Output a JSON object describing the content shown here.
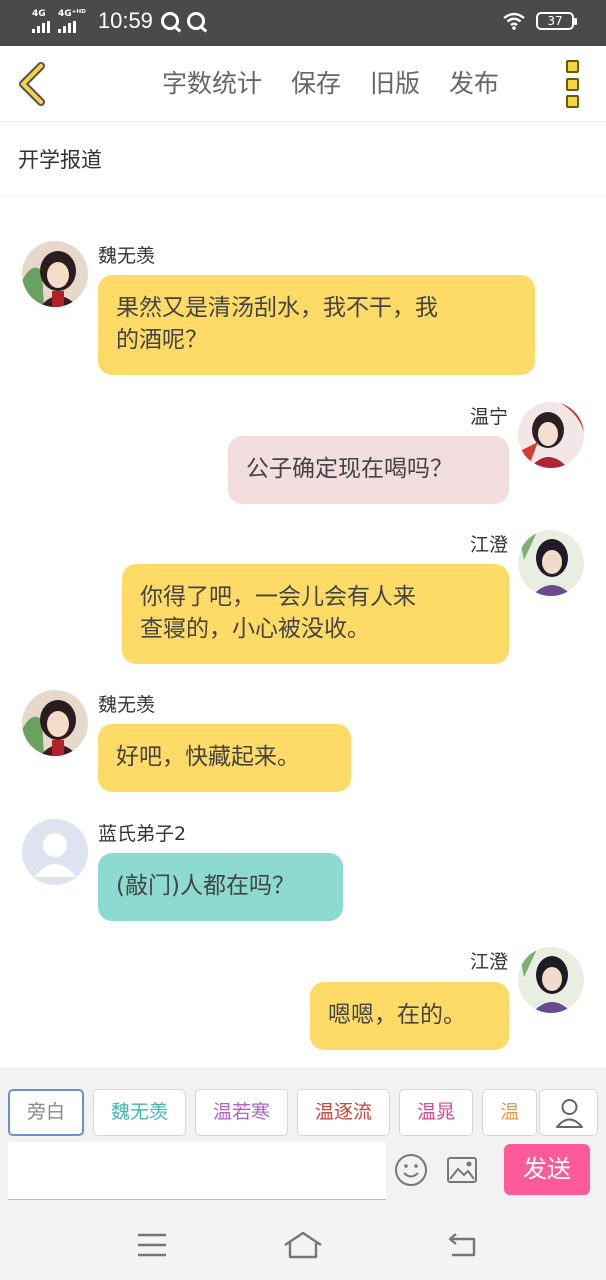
{
  "status_bar": {
    "signal1_label": "4G",
    "signal2_label": "4G⁺ᴴᴰ",
    "time": "10:59",
    "battery": "37"
  },
  "toolbar": {
    "word_count": "字数统计",
    "save": "保存",
    "old_version": "旧版",
    "publish": "发布"
  },
  "story_title": "开学报道",
  "messages": [
    {
      "side": "left",
      "name": "魏无羡",
      "avatar": "wei-wuxian-avatar",
      "text_lines": [
        "果然又是清汤刮水，我不干，我",
        "的酒呢？"
      ],
      "bubble_color": "#fedb67"
    },
    {
      "side": "right",
      "name": "温宁",
      "avatar": "wen-ning-avatar",
      "text_lines": [
        "公子确定现在喝吗？"
      ],
      "bubble_color": "#f2dedf"
    },
    {
      "side": "right",
      "name": "江澄",
      "avatar": "jiang-cheng-avatar",
      "text_lines": [
        "你得了吧，一会儿会有人来",
        "查寝的，小心被没收。"
      ],
      "bubble_color": "#fedb67"
    },
    {
      "side": "left",
      "name": "魏无羡",
      "avatar": "wei-wuxian-avatar",
      "text_lines": [
        "好吧，快藏起来。"
      ],
      "bubble_color": "#fedb67"
    },
    {
      "side": "left",
      "name": "蓝氏弟子2",
      "avatar": "default-user-avatar",
      "text_lines": [
        "(敲门)人都在吗？"
      ],
      "bubble_color": "#8cdad0"
    },
    {
      "side": "right",
      "name": "江澄",
      "avatar": "jiang-cheng-avatar",
      "text_lines": [
        "嗯嗯，在的。"
      ],
      "bubble_color": "#fedb67"
    }
  ],
  "roles": [
    {
      "label": "旁白",
      "color": "#888888",
      "selected": true
    },
    {
      "label": "魏无羡",
      "color": "#3fb8b0",
      "selected": false
    },
    {
      "label": "温若寒",
      "color": "#b063cc",
      "selected": false
    },
    {
      "label": "温逐流",
      "color": "#c8463e",
      "selected": false
    },
    {
      "label": "温晁",
      "color": "#d94a8c",
      "selected": false
    },
    {
      "label": "温",
      "color": "#e89a4a",
      "selected": false
    }
  ],
  "composer": {
    "input_value": "",
    "send_label": "发送"
  },
  "icons": {
    "back": "chevron-left-icon",
    "more": "more-icon",
    "person": "person-icon",
    "emoji": "emoji-icon",
    "image": "image-icon",
    "nav_menu": "menu-icon",
    "nav_home": "home-icon",
    "nav_back": "back-icon"
  }
}
